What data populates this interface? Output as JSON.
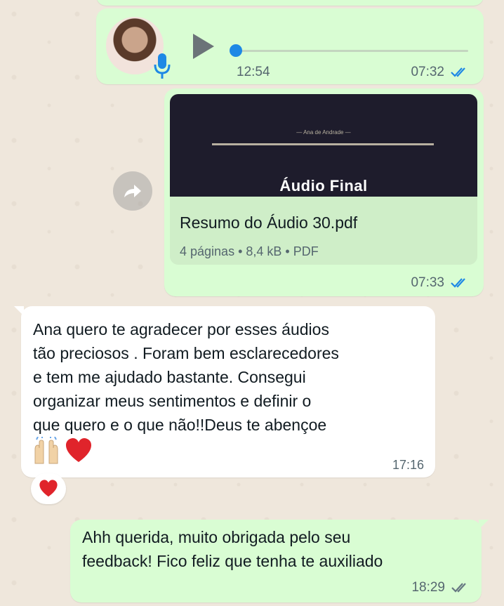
{
  "voice_note": {
    "duration": "12:54",
    "time": "07:32",
    "status": "read"
  },
  "document": {
    "preview_small": "— Ana de Andrade —",
    "preview_title": "Áudio Final",
    "name": "Resumo do Áudio 30.pdf",
    "info": "4 páginas • 8,4 kB • PDF",
    "time": "07:33",
    "status": "read"
  },
  "incoming": {
    "text": "Ana quero te agradecer por esses áudios\ntão preciosos . Foram bem esclarecedores\ne tem me ajudado bastante. Consegui\norganizar meus sentimentos e definir o\nque quero e o que não!!Deus te abençoe",
    "emojis": [
      "raising-hands",
      "red-heart"
    ],
    "time": "17:16",
    "reaction": "red-heart"
  },
  "outgoing": {
    "text": "Ahh querida, muito obrigada pelo seu\nfeedback! Fico feliz que tenha te auxiliado",
    "time": "18:29",
    "status": "delivered"
  },
  "colors": {
    "outgoing_bubble": "#d9fdd3",
    "incoming_bubble": "#ffffff",
    "read_ticks": "#1e88e5",
    "delivered_ticks": "#667781",
    "background": "#efe7dc"
  }
}
